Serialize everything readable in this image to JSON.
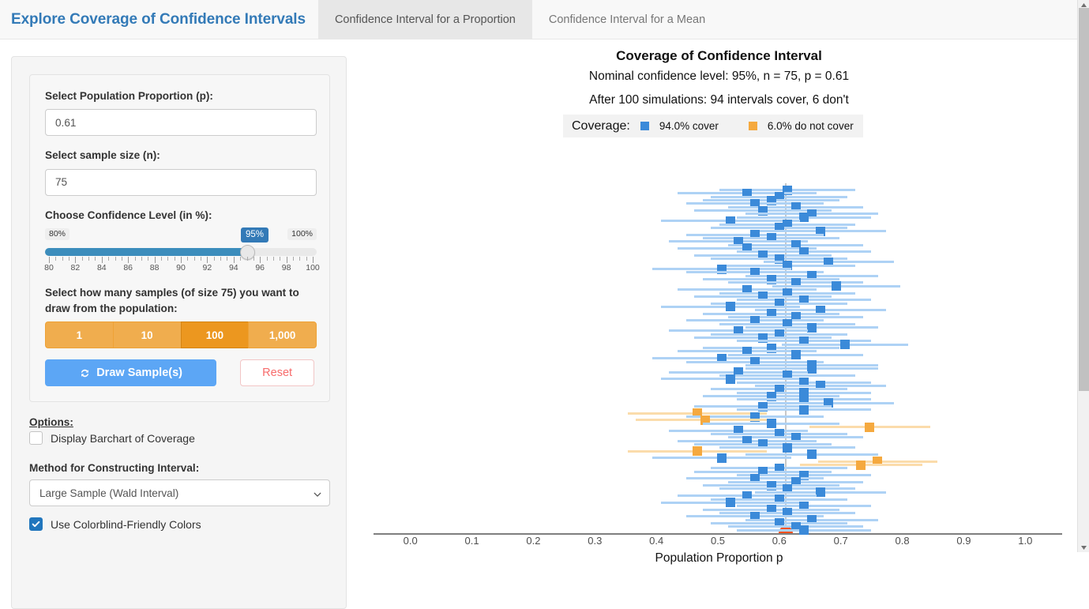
{
  "navbar": {
    "brand": "Explore Coverage of Confidence Intervals",
    "tabs": [
      {
        "label": "Confidence Interval for a Proportion",
        "active": true
      },
      {
        "label": "Confidence Interval for a Mean",
        "active": false
      }
    ]
  },
  "sidebar": {
    "proportion": {
      "label": "Select Population Proportion (p):",
      "value": "0.61"
    },
    "sample_size": {
      "label": "Select sample size (n):",
      "value": "75"
    },
    "confidence": {
      "label": "Choose Confidence Level (in %):",
      "min_label": "80%",
      "max_label": "100%",
      "current_label": "95%",
      "min": 80,
      "max": 100,
      "value": 95,
      "tick_labels": [
        "80",
        "82",
        "84",
        "86",
        "88",
        "90",
        "92",
        "94",
        "96",
        "98",
        "100"
      ]
    },
    "samples": {
      "label": "Select how many samples (of size 75) you want to draw from the population:",
      "options": [
        "1",
        "10",
        "100",
        "1,000"
      ],
      "selected_index": 2
    },
    "draw_button": "Draw Sample(s)",
    "reset_button": "Reset",
    "options": {
      "heading": "Options:",
      "barchart": {
        "label": "Display Barchart of Coverage",
        "checked": false
      },
      "method": {
        "label": "Method for Constructing Interval:",
        "value": "Large Sample (Wald Interval)"
      },
      "colorblind": {
        "label": "Use Colorblind-Friendly Colors",
        "checked": true
      }
    }
  },
  "colors": {
    "brand": "#337ab7",
    "cover_line": "#aed2f5",
    "cover_marker": "#3b8ad9",
    "miss_line": "#fbdcab",
    "miss_marker": "#f5a93f",
    "true_value_marker": "#f4511e",
    "reference_line": "#c8c8c8",
    "draw_button": "#5ca6f5",
    "sample_button": "#f0ad4e",
    "sample_button_active": "#ec971f",
    "reset_text": "#f76c6c"
  },
  "chart_data": {
    "type": "scatter",
    "title": "Coverage of Confidence Interval",
    "subtitle_1": "Nominal confidence level: 95%, n = 75, p = 0.61",
    "subtitle_2": "After 100 simulations: 94 intervals cover, 6 don't",
    "xlabel": "Population Proportion p",
    "ylabel": "",
    "xlim": [
      -0.06,
      1.06
    ],
    "xticks": [
      0.0,
      0.1,
      0.2,
      0.3,
      0.4,
      0.5,
      0.6,
      0.7,
      0.8,
      0.9,
      1.0
    ],
    "xtick_labels": [
      "0.0",
      "0.1",
      "0.2",
      "0.3",
      "0.4",
      "0.5",
      "0.6",
      "0.7",
      "0.8",
      "0.9",
      "1.0"
    ],
    "grid": false,
    "true_p": 0.61,
    "n": 75,
    "confidence_level": 95,
    "n_simulations": 100,
    "n_cover": 94,
    "n_miss": 6,
    "legend": {
      "position": "top",
      "title": "Coverage:",
      "entries": [
        {
          "label": "94.0% cover",
          "color": "#3b8ad9"
        },
        {
          "label": "6.0% do not cover",
          "color": "#f5a93f"
        }
      ]
    },
    "intervals": [
      {
        "i": 1,
        "estimate": 0.613,
        "lower": 0.503,
        "upper": 0.723,
        "covers": true
      },
      {
        "i": 2,
        "estimate": 0.547,
        "lower": 0.434,
        "upper": 0.66,
        "covers": true
      },
      {
        "i": 3,
        "estimate": 0.6,
        "lower": 0.489,
        "upper": 0.711,
        "covers": true
      },
      {
        "i": 4,
        "estimate": 0.587,
        "lower": 0.476,
        "upper": 0.698,
        "covers": true
      },
      {
        "i": 5,
        "estimate": 0.56,
        "lower": 0.448,
        "upper": 0.672,
        "covers": true
      },
      {
        "i": 6,
        "estimate": 0.627,
        "lower": 0.517,
        "upper": 0.736,
        "covers": true
      },
      {
        "i": 7,
        "estimate": 0.573,
        "lower": 0.461,
        "upper": 0.685,
        "covers": true
      },
      {
        "i": 8,
        "estimate": 0.653,
        "lower": 0.545,
        "upper": 0.761,
        "covers": true
      },
      {
        "i": 9,
        "estimate": 0.64,
        "lower": 0.531,
        "upper": 0.749,
        "covers": true
      },
      {
        "i": 10,
        "estimate": 0.52,
        "lower": 0.407,
        "upper": 0.633,
        "covers": true
      },
      {
        "i": 11,
        "estimate": 0.613,
        "lower": 0.503,
        "upper": 0.723,
        "covers": true
      },
      {
        "i": 12,
        "estimate": 0.6,
        "lower": 0.489,
        "upper": 0.711,
        "covers": true
      },
      {
        "i": 13,
        "estimate": 0.667,
        "lower": 0.56,
        "upper": 0.774,
        "covers": true
      },
      {
        "i": 14,
        "estimate": 0.56,
        "lower": 0.448,
        "upper": 0.672,
        "covers": true
      },
      {
        "i": 15,
        "estimate": 0.587,
        "lower": 0.476,
        "upper": 0.698,
        "covers": true
      },
      {
        "i": 16,
        "estimate": 0.533,
        "lower": 0.42,
        "upper": 0.646,
        "covers": true
      },
      {
        "i": 17,
        "estimate": 0.627,
        "lower": 0.517,
        "upper": 0.736,
        "covers": true
      },
      {
        "i": 18,
        "estimate": 0.547,
        "lower": 0.434,
        "upper": 0.66,
        "covers": true
      },
      {
        "i": 19,
        "estimate": 0.64,
        "lower": 0.531,
        "upper": 0.749,
        "covers": true
      },
      {
        "i": 20,
        "estimate": 0.573,
        "lower": 0.461,
        "upper": 0.685,
        "covers": true
      },
      {
        "i": 21,
        "estimate": 0.6,
        "lower": 0.489,
        "upper": 0.711,
        "covers": true
      },
      {
        "i": 22,
        "estimate": 0.68,
        "lower": 0.574,
        "upper": 0.786,
        "covers": true
      },
      {
        "i": 23,
        "estimate": 0.613,
        "lower": 0.503,
        "upper": 0.723,
        "covers": true
      },
      {
        "i": 24,
        "estimate": 0.507,
        "lower": 0.394,
        "upper": 0.62,
        "covers": true
      },
      {
        "i": 25,
        "estimate": 0.56,
        "lower": 0.448,
        "upper": 0.672,
        "covers": true
      },
      {
        "i": 26,
        "estimate": 0.653,
        "lower": 0.545,
        "upper": 0.761,
        "covers": true
      },
      {
        "i": 27,
        "estimate": 0.587,
        "lower": 0.476,
        "upper": 0.698,
        "covers": true
      },
      {
        "i": 28,
        "estimate": 0.627,
        "lower": 0.517,
        "upper": 0.736,
        "covers": true
      },
      {
        "i": 29,
        "estimate": 0.693,
        "lower": 0.589,
        "upper": 0.797,
        "covers": true
      },
      {
        "i": 30,
        "estimate": 0.547,
        "lower": 0.434,
        "upper": 0.66,
        "covers": true
      },
      {
        "i": 31,
        "estimate": 0.613,
        "lower": 0.503,
        "upper": 0.723,
        "covers": true
      },
      {
        "i": 32,
        "estimate": 0.573,
        "lower": 0.461,
        "upper": 0.685,
        "covers": true
      },
      {
        "i": 33,
        "estimate": 0.64,
        "lower": 0.531,
        "upper": 0.749,
        "covers": true
      },
      {
        "i": 34,
        "estimate": 0.6,
        "lower": 0.489,
        "upper": 0.711,
        "covers": true
      },
      {
        "i": 35,
        "estimate": 0.52,
        "lower": 0.407,
        "upper": 0.633,
        "covers": true
      },
      {
        "i": 36,
        "estimate": 0.667,
        "lower": 0.56,
        "upper": 0.774,
        "covers": true
      },
      {
        "i": 37,
        "estimate": 0.587,
        "lower": 0.476,
        "upper": 0.698,
        "covers": true
      },
      {
        "i": 38,
        "estimate": 0.627,
        "lower": 0.517,
        "upper": 0.736,
        "covers": true
      },
      {
        "i": 39,
        "estimate": 0.56,
        "lower": 0.448,
        "upper": 0.672,
        "covers": true
      },
      {
        "i": 40,
        "estimate": 0.613,
        "lower": 0.503,
        "upper": 0.723,
        "covers": true
      },
      {
        "i": 41,
        "estimate": 0.653,
        "lower": 0.545,
        "upper": 0.761,
        "covers": true
      },
      {
        "i": 42,
        "estimate": 0.533,
        "lower": 0.42,
        "upper": 0.646,
        "covers": true
      },
      {
        "i": 43,
        "estimate": 0.6,
        "lower": 0.489,
        "upper": 0.711,
        "covers": true
      },
      {
        "i": 44,
        "estimate": 0.573,
        "lower": 0.461,
        "upper": 0.685,
        "covers": true
      },
      {
        "i": 45,
        "estimate": 0.64,
        "lower": 0.531,
        "upper": 0.749,
        "covers": true
      },
      {
        "i": 46,
        "estimate": 0.707,
        "lower": 0.604,
        "upper": 0.81,
        "covers": true
      },
      {
        "i": 47,
        "estimate": 0.587,
        "lower": 0.476,
        "upper": 0.698,
        "covers": true
      },
      {
        "i": 48,
        "estimate": 0.547,
        "lower": 0.434,
        "upper": 0.66,
        "covers": true
      },
      {
        "i": 49,
        "estimate": 0.627,
        "lower": 0.517,
        "upper": 0.736,
        "covers": true
      },
      {
        "i": 50,
        "estimate": 0.507,
        "lower": 0.394,
        "upper": 0.62,
        "covers": true
      },
      {
        "i": 51,
        "estimate": 0.56,
        "lower": 0.448,
        "upper": 0.672,
        "covers": true
      },
      {
        "i": 52,
        "estimate": 0.653,
        "lower": 0.545,
        "upper": 0.761,
        "covers": true
      },
      {
        "i": 53,
        "estimate": 0.653,
        "lower": 0.545,
        "upper": 0.761,
        "covers": true
      },
      {
        "i": 54,
        "estimate": 0.533,
        "lower": 0.42,
        "upper": 0.646,
        "covers": true
      },
      {
        "i": 55,
        "estimate": 0.613,
        "lower": 0.503,
        "upper": 0.723,
        "covers": true
      },
      {
        "i": 56,
        "estimate": 0.52,
        "lower": 0.407,
        "upper": 0.633,
        "covers": true
      },
      {
        "i": 57,
        "estimate": 0.64,
        "lower": 0.531,
        "upper": 0.749,
        "covers": true
      },
      {
        "i": 58,
        "estimate": 0.667,
        "lower": 0.56,
        "upper": 0.774,
        "covers": true
      },
      {
        "i": 59,
        "estimate": 0.6,
        "lower": 0.489,
        "upper": 0.711,
        "covers": true
      },
      {
        "i": 60,
        "estimate": 0.64,
        "lower": 0.531,
        "upper": 0.749,
        "covers": true
      },
      {
        "i": 61,
        "estimate": 0.587,
        "lower": 0.476,
        "upper": 0.698,
        "covers": true
      },
      {
        "i": 62,
        "estimate": 0.64,
        "lower": 0.531,
        "upper": 0.749,
        "covers": true
      },
      {
        "i": 63,
        "estimate": 0.68,
        "lower": 0.574,
        "upper": 0.786,
        "covers": true
      },
      {
        "i": 64,
        "estimate": 0.573,
        "lower": 0.461,
        "upper": 0.685,
        "covers": true
      },
      {
        "i": 65,
        "estimate": 0.64,
        "lower": 0.531,
        "upper": 0.749,
        "covers": true
      },
      {
        "i": 66,
        "estimate": 0.467,
        "lower": 0.354,
        "upper": 0.58,
        "covers": false
      },
      {
        "i": 67,
        "estimate": 0.56,
        "lower": 0.448,
        "upper": 0.672,
        "covers": true
      },
      {
        "i": 68,
        "estimate": 0.48,
        "lower": 0.367,
        "upper": 0.593,
        "covers": false
      },
      {
        "i": 69,
        "estimate": 0.587,
        "lower": 0.476,
        "upper": 0.698,
        "covers": true
      },
      {
        "i": 70,
        "estimate": 0.747,
        "lower": 0.649,
        "upper": 0.845,
        "covers": false
      },
      {
        "i": 71,
        "estimate": 0.533,
        "lower": 0.42,
        "upper": 0.646,
        "covers": true
      },
      {
        "i": 72,
        "estimate": 0.6,
        "lower": 0.489,
        "upper": 0.711,
        "covers": true
      },
      {
        "i": 73,
        "estimate": 0.627,
        "lower": 0.517,
        "upper": 0.736,
        "covers": true
      },
      {
        "i": 74,
        "estimate": 0.547,
        "lower": 0.434,
        "upper": 0.66,
        "covers": true
      },
      {
        "i": 75,
        "estimate": 0.573,
        "lower": 0.461,
        "upper": 0.685,
        "covers": true
      },
      {
        "i": 76,
        "estimate": 0.613,
        "lower": 0.503,
        "upper": 0.723,
        "covers": true
      },
      {
        "i": 77,
        "estimate": 0.467,
        "lower": 0.354,
        "upper": 0.58,
        "covers": false
      },
      {
        "i": 78,
        "estimate": 0.653,
        "lower": 0.545,
        "upper": 0.761,
        "covers": true
      },
      {
        "i": 79,
        "estimate": 0.507,
        "lower": 0.394,
        "upper": 0.62,
        "covers": true
      },
      {
        "i": 80,
        "estimate": 0.76,
        "lower": 0.663,
        "upper": 0.857,
        "covers": false
      },
      {
        "i": 81,
        "estimate": 0.733,
        "lower": 0.633,
        "upper": 0.833,
        "covers": false
      },
      {
        "i": 82,
        "estimate": 0.6,
        "lower": 0.489,
        "upper": 0.711,
        "covers": true
      },
      {
        "i": 83,
        "estimate": 0.573,
        "lower": 0.461,
        "upper": 0.685,
        "covers": true
      },
      {
        "i": 84,
        "estimate": 0.64,
        "lower": 0.531,
        "upper": 0.749,
        "covers": true
      },
      {
        "i": 85,
        "estimate": 0.56,
        "lower": 0.448,
        "upper": 0.672,
        "covers": true
      },
      {
        "i": 86,
        "estimate": 0.627,
        "lower": 0.517,
        "upper": 0.736,
        "covers": true
      },
      {
        "i": 87,
        "estimate": 0.587,
        "lower": 0.476,
        "upper": 0.698,
        "covers": true
      },
      {
        "i": 88,
        "estimate": 0.613,
        "lower": 0.503,
        "upper": 0.723,
        "covers": true
      },
      {
        "i": 89,
        "estimate": 0.667,
        "lower": 0.56,
        "upper": 0.774,
        "covers": true
      },
      {
        "i": 90,
        "estimate": 0.547,
        "lower": 0.434,
        "upper": 0.66,
        "covers": true
      },
      {
        "i": 91,
        "estimate": 0.6,
        "lower": 0.489,
        "upper": 0.711,
        "covers": true
      },
      {
        "i": 92,
        "estimate": 0.52,
        "lower": 0.407,
        "upper": 0.633,
        "covers": true
      },
      {
        "i": 93,
        "estimate": 0.64,
        "lower": 0.531,
        "upper": 0.749,
        "covers": true
      },
      {
        "i": 94,
        "estimate": 0.587,
        "lower": 0.476,
        "upper": 0.698,
        "covers": true
      },
      {
        "i": 95,
        "estimate": 0.613,
        "lower": 0.503,
        "upper": 0.723,
        "covers": true
      },
      {
        "i": 96,
        "estimate": 0.56,
        "lower": 0.448,
        "upper": 0.672,
        "covers": true
      },
      {
        "i": 97,
        "estimate": 0.653,
        "lower": 0.545,
        "upper": 0.761,
        "covers": true
      },
      {
        "i": 98,
        "estimate": 0.6,
        "lower": 0.489,
        "upper": 0.711,
        "covers": true
      },
      {
        "i": 99,
        "estimate": 0.627,
        "lower": 0.517,
        "upper": 0.736,
        "covers": true
      },
      {
        "i": 100,
        "estimate": 0.64,
        "lower": 0.531,
        "upper": 0.749,
        "covers": true
      }
    ]
  }
}
